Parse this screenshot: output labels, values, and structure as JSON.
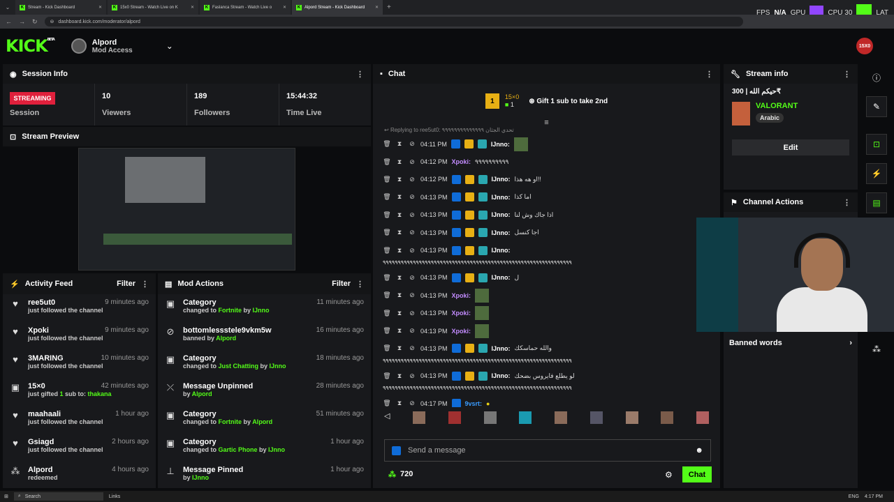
{
  "browser": {
    "tabs": [
      {
        "label": "Stream - Kick Dashboard"
      },
      {
        "label": "15x0 Stream - Watch Live on K"
      },
      {
        "label": "Faslanca Stream - Watch Live o"
      },
      {
        "label": "Alpord Stream - Kick Dashboard"
      }
    ],
    "url": "dashboard.kick.com/moderator/alpord"
  },
  "hud": {
    "fps_label": "FPS",
    "fps_value": "N/A",
    "gpu_label": "GPU",
    "cpu_label": "CPU 30",
    "lat_label": "LAT"
  },
  "header": {
    "logo": "KICK",
    "beta": "BETA",
    "username": "Alpord",
    "role": "Mod Access",
    "brand_badge": "15X0"
  },
  "session": {
    "title": "Session Info",
    "status": "STREAMING",
    "status_label": "Session",
    "stats": [
      {
        "value": "10",
        "label": "Viewers"
      },
      {
        "value": "189",
        "label": "Followers"
      },
      {
        "value": "15:44:32",
        "label": "Time Live"
      }
    ]
  },
  "preview": {
    "title": "Stream Preview"
  },
  "activity": {
    "title": "Activity Feed",
    "filter": "Filter",
    "items": [
      {
        "name": "ree5ut0",
        "time": "9 minutes ago",
        "desc": "just followed the channel"
      },
      {
        "name": "Xpoki",
        "time": "9 minutes ago",
        "desc": "just followed the channel"
      },
      {
        "name": "3MARING",
        "time": "10 minutes ago",
        "desc": "just followed the channel"
      },
      {
        "name": "15×0",
        "time": "42 minutes ago",
        "desc_pre": "just gifted ",
        "desc_count": "1",
        "desc_mid": " sub to: ",
        "desc_target": "thakana"
      },
      {
        "name": "maahaali",
        "time": "1 hour ago",
        "desc": "just followed the channel"
      },
      {
        "name": "Gsiagd",
        "time": "2 hours ago",
        "desc": "just followed the channel"
      },
      {
        "name": "Alpord",
        "time": "4 hours ago",
        "desc": "redeemed"
      }
    ]
  },
  "modactions": {
    "title": "Mod Actions",
    "filter": "Filter",
    "items": [
      {
        "name": "Category",
        "time": "11 minutes ago",
        "pre": "changed to ",
        "hl": "Fortnite",
        "mid": " by ",
        "by": "IJnno"
      },
      {
        "name": "bottomlessstele9vkm5w",
        "time": "16 minutes ago",
        "pre": "banned by ",
        "hl": "",
        "mid": "",
        "by": "Alpord"
      },
      {
        "name": "Category",
        "time": "18 minutes ago",
        "pre": "changed to ",
        "hl": "Just Chatting",
        "mid": " by ",
        "by": "IJnno"
      },
      {
        "name": "Message Unpinned",
        "time": "28 minutes ago",
        "pre": "by ",
        "hl": "",
        "mid": "",
        "by": "Alpord"
      },
      {
        "name": "Category",
        "time": "51 minutes ago",
        "pre": "changed to ",
        "hl": "Fortnite",
        "mid": " by ",
        "by": "Alpord"
      },
      {
        "name": "Category",
        "time": "1 hour ago",
        "pre": "changed to ",
        "hl": "Gartic Phone",
        "mid": " by ",
        "by": "IJnno"
      },
      {
        "name": "Message Pinned",
        "time": "1 hour ago",
        "pre": "by ",
        "hl": "",
        "mid": "",
        "by": "IJnno"
      }
    ]
  },
  "chat": {
    "title": "Chat",
    "gift_count": "15×0",
    "gift_sub": "1",
    "gift_cta": "Gift 1 sub to take 2nd",
    "reply_to": "Replying to ree5ut0: تحدي الجثان ٩٩٩٩٩٩٩٩٩٩٩٩٩٩",
    "messages": [
      {
        "time": "04:11 PM",
        "user": "IJnno:",
        "text": ""
      },
      {
        "time": "04:12 PM",
        "user": "Xpoki:",
        "text": "٩٩٩٩٩٩٩٩٩٩"
      },
      {
        "time": "04:12 PM",
        "user": "IJnno:",
        "text": "او هه هذا!!"
      },
      {
        "time": "04:13 PM",
        "user": "IJnno:",
        "text": "اما كذا"
      },
      {
        "time": "04:13 PM",
        "user": "IJnno:",
        "text": "اذا جاك وش لنا"
      },
      {
        "time": "04:13 PM",
        "user": "IJnno:",
        "text": "اجا كنسل"
      },
      {
        "time": "04:13 PM",
        "user": "IJnno:",
        "text": ""
      },
      {
        "time": "04:13 PM",
        "user": "IJnno:",
        "text": "ل"
      },
      {
        "time": "04:13 PM",
        "user": "Xpoki:",
        "text": ""
      },
      {
        "time": "04:13 PM",
        "user": "Xpoki:",
        "text": ""
      },
      {
        "time": "04:13 PM",
        "user": "Xpoki:",
        "text": ""
      },
      {
        "time": "04:13 PM",
        "user": "IJnno:",
        "text": "والله حماسكك"
      },
      {
        "time": "04:13 PM",
        "user": "IJnno:",
        "text": "لو يطلع فايروس بضحك"
      },
      {
        "time": "04:17 PM",
        "user": "9vsrt:",
        "text": ""
      }
    ],
    "spam_line": "٩٩٩٩٩٩٩٩٩٩٩٩٩٩٩٩٩٩٩٩٩٩٩٩٩٩٩٩٩٩٩٩٩٩٩٩٩٩٩٩٩٩٩٩٩٩٩٩٩٩٩٩٩٩٩٩٩٩٩٩٩٩٩",
    "placeholder": "Send a message",
    "points": "720",
    "send": "Chat"
  },
  "streaminfo": {
    "title": "Stream info",
    "stream_title": "حيكم الله | 300₹",
    "category": "VALORANT",
    "tag": "Arabic",
    "edit": "Edit"
  },
  "channel_actions": {
    "title": "Channel Actions",
    "banned_words": "Banned words"
  },
  "taskbar": {
    "search": "Search",
    "links": "Links",
    "lang": "ENG",
    "time": "4:17 PM"
  }
}
